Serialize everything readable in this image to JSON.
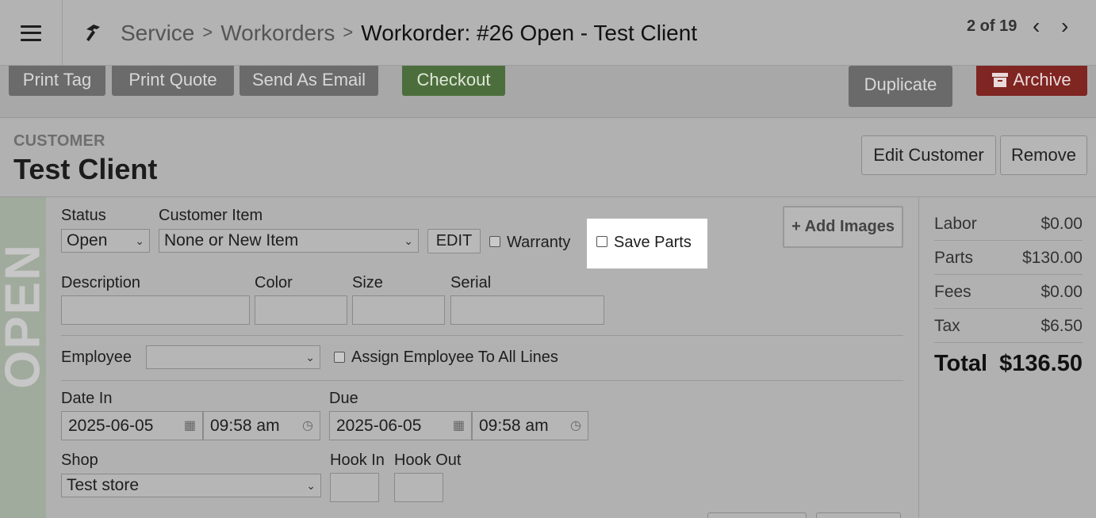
{
  "header": {
    "breadcrumb": [
      "Service",
      "Workorders"
    ],
    "title": "Workorder:  #26 Open - Test Client",
    "pager": "2 of 19"
  },
  "toolbar": {
    "print_tag": "Print Tag",
    "print_quote": "Print Quote",
    "send_email": "Send As Email",
    "checkout": "Checkout",
    "duplicate": "Duplicate",
    "archive": "Archive"
  },
  "customer": {
    "label": "CUSTOMER",
    "name": "Test Client",
    "edit_button": "Edit Customer",
    "remove_button": "Remove"
  },
  "status_strip": "OPEN",
  "form": {
    "status_label": "Status",
    "status_value": "Open",
    "customer_item_label": "Customer Item",
    "customer_item_value": "None or New Item",
    "edit_button": "EDIT",
    "warranty_label": "Warranty",
    "save_parts_label": "Save Parts",
    "add_images_button": "Add Images",
    "description_label": "Description",
    "color_label": "Color",
    "size_label": "Size",
    "serial_label": "Serial",
    "employee_label": "Employee",
    "employee_value": "",
    "assign_all_label": "Assign Employee To All Lines",
    "date_in_label": "Date In",
    "date_in_date": "2025-06-05",
    "date_in_time": "09:58 am",
    "due_label": "Due",
    "due_date": "2025-06-05",
    "due_time": "09:58 am",
    "shop_label": "Shop",
    "shop_value": "Test store",
    "hook_in_label": "Hook In",
    "hook_out_label": "Hook Out"
  },
  "totals": {
    "rows": [
      {
        "label": "Labor",
        "value": "$0.00"
      },
      {
        "label": "Parts",
        "value": "$130.00"
      },
      {
        "label": "Fees",
        "value": "$0.00"
      },
      {
        "label": "Tax",
        "value": "$6.50"
      }
    ],
    "total_label": "Total",
    "total_value": "$136.50"
  },
  "colors": {
    "checkout": "#4c6e3c",
    "archive": "#7f2522",
    "status_strip": "#a1ab9d"
  }
}
